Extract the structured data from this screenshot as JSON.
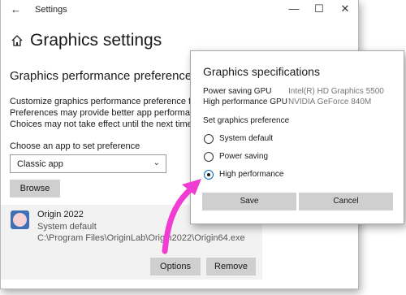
{
  "window": {
    "title": "Settings",
    "back_glyph": "←",
    "minimize_glyph": "—",
    "maximize_glyph": "☐",
    "close_glyph": "✕"
  },
  "header": {
    "title": "Graphics settings",
    "home_icon": "home-icon"
  },
  "section": {
    "title": "Graphics performance preference",
    "description": [
      "Customize graphics performance preference for spe",
      "Preferences may provide better app performance or",
      "Choices may not take effect until the next time the a"
    ]
  },
  "app_picker": {
    "label": "Choose an app to set preference",
    "selected": "Classic app",
    "browse_label": "Browse"
  },
  "app_card": {
    "name": "Origin 2022",
    "status": "System default",
    "path": "C:\\Program Files\\OriginLab\\Origin2022\\Origin64.exe",
    "options_label": "Options",
    "remove_label": "Remove"
  },
  "dialog": {
    "title": "Graphics specifications",
    "specs": [
      {
        "label": "Power saving GPU",
        "value": "Intel(R) HD Graphics 5500"
      },
      {
        "label": "High performance GPU",
        "value": "NVIDIA GeForce 840M"
      }
    ],
    "set_label": "Set graphics preference",
    "options": [
      {
        "label": "System default",
        "selected": false
      },
      {
        "label": "Power saving",
        "selected": false
      },
      {
        "label": "High performance",
        "selected": true
      }
    ],
    "save_label": "Save",
    "cancel_label": "Cancel"
  },
  "colors": {
    "annotation_arrow": "#f03cd2",
    "accent": "#0067c0"
  }
}
